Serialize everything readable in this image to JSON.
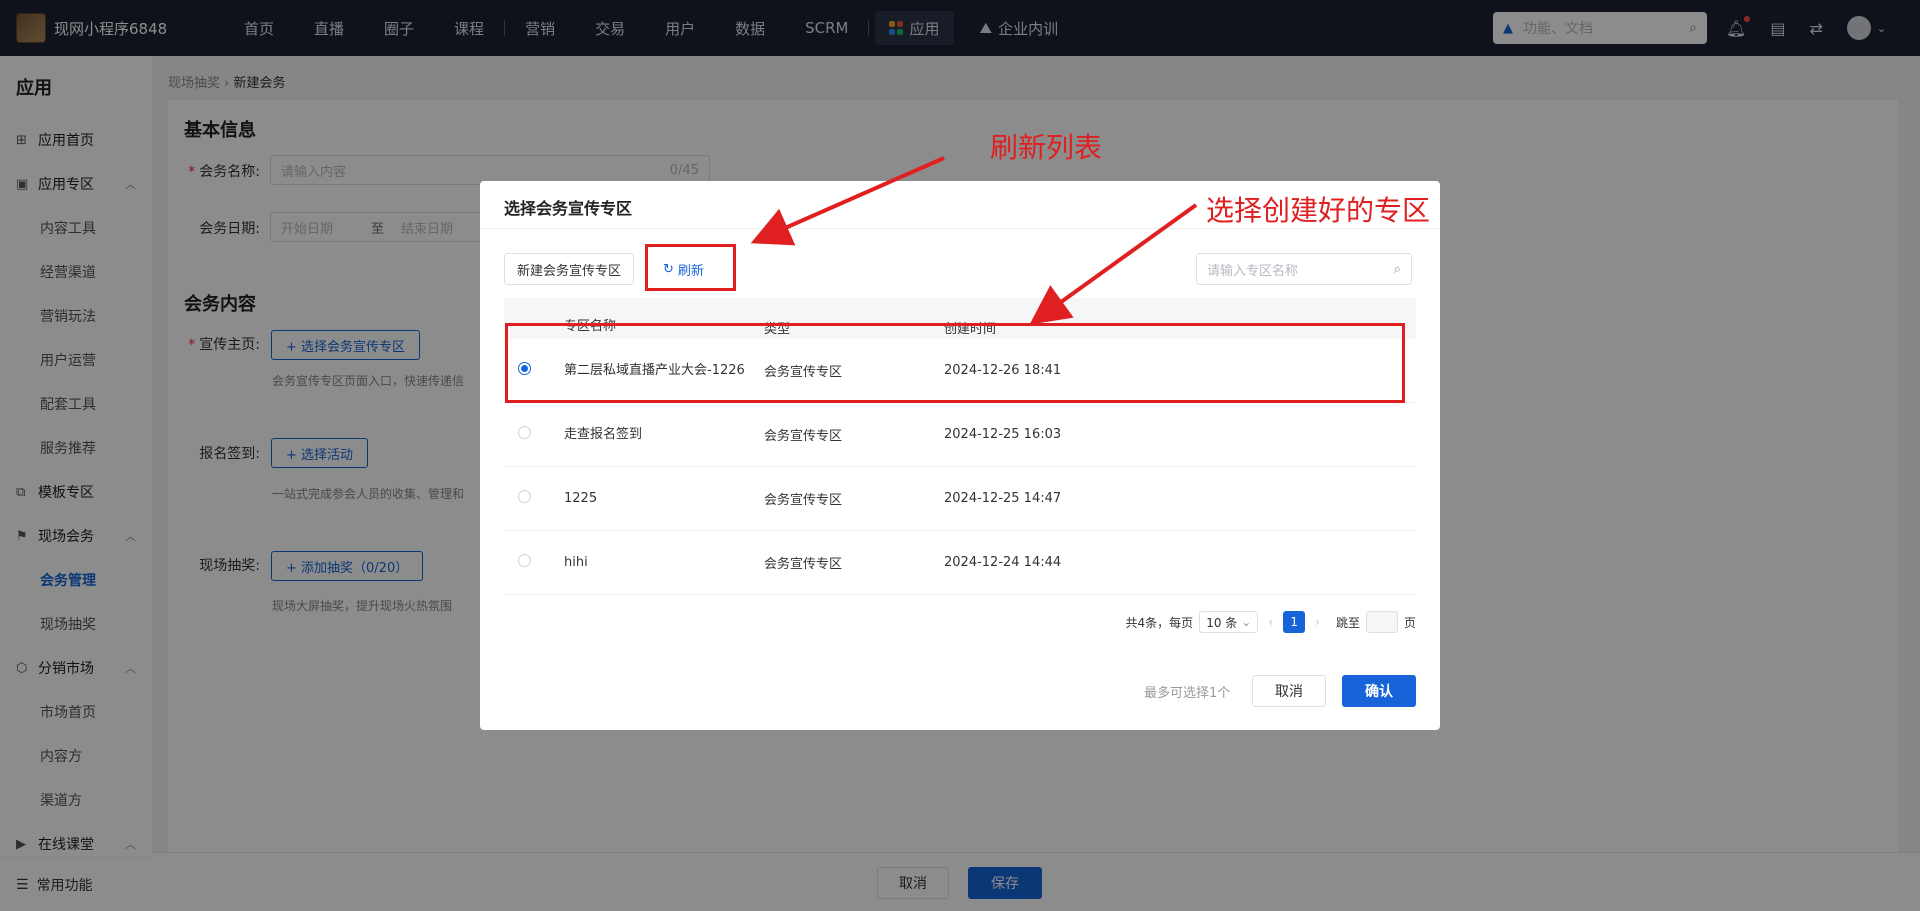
{
  "topbar": {
    "app_name": "现网小程序6848",
    "nav": [
      "首页",
      "直播",
      "圈子",
      "课程",
      "营销",
      "交易",
      "用户",
      "数据",
      "SCRM"
    ],
    "nav_active": "应用",
    "nav_extra": "企业内训",
    "search_placeholder": "功能、文档"
  },
  "sidebar": {
    "title": "应用",
    "home": "应用首页",
    "group_app_zone": "应用专区",
    "app_zone_items": [
      "内容工具",
      "经营渠道",
      "营销玩法",
      "用户运营",
      "配套工具",
      "服务推荐"
    ],
    "template_zone": "模板专区",
    "group_onsite": "现场会务",
    "onsite_items": [
      "会务管理",
      "现场抽奖"
    ],
    "group_market": "分销市场",
    "market_items": [
      "市场首页",
      "内容方",
      "渠道方"
    ],
    "group_online": "在线课堂",
    "common": "常用功能"
  },
  "breadcrumb": {
    "parent": "现场抽奖",
    "current": "新建会务"
  },
  "form": {
    "basic_title": "基本信息",
    "name_label": "会务名称:",
    "name_placeholder": "请输入内容",
    "name_counter": "0/45",
    "date_label": "会务日期:",
    "date_start": "开始日期",
    "date_sep": "至",
    "date_end": "结束日期",
    "content_title": "会务内容",
    "promo_label": "宣传主页:",
    "promo_button": "+ 选择会务宣传专区",
    "promo_hint": "会务宣传专区页面入口，快速传递信",
    "signup_label": "报名签到:",
    "signup_button": "+ 选择活动",
    "signup_hint": "一站式完成参会人员的收集、管理和",
    "lottery_label": "现场抽奖:",
    "lottery_button": "+ 添加抽奖（0/20）",
    "lottery_hint": "现场大屏抽奖，提升现场火热氛围"
  },
  "page_footer": {
    "cancel": "取消",
    "save": "保存"
  },
  "modal": {
    "title": "选择会务宣传专区",
    "new_button": "新建会务宣传专区",
    "refresh_button": "刷新",
    "search_placeholder": "请输入专区名称",
    "columns": {
      "name": "专区名称",
      "type": "类型",
      "time": "创建时间"
    },
    "rows": [
      {
        "name": "第二层私域直播产业大会-1226",
        "type": "会务宣传专区",
        "time": "2024-12-26 18:41",
        "checked": true
      },
      {
        "name": "走查报名签到",
        "type": "会务宣传专区",
        "time": "2024-12-25 16:03",
        "checked": false
      },
      {
        "name": "1225",
        "type": "会务宣传专区",
        "time": "2024-12-25 14:47",
        "checked": false
      },
      {
        "name": "hihi",
        "type": "会务宣传专区",
        "time": "2024-12-24 14:44",
        "checked": false
      }
    ],
    "pager": {
      "total": "共4条，每页",
      "size": "10 条",
      "page": "1",
      "jump": "跳至",
      "page_unit": "页"
    },
    "max_note": "最多可选择1个",
    "cancel": "取消",
    "confirm": "确认"
  },
  "annotations": {
    "refresh": "刷新列表",
    "select": "选择创建好的专区",
    "color": "#e02020"
  }
}
